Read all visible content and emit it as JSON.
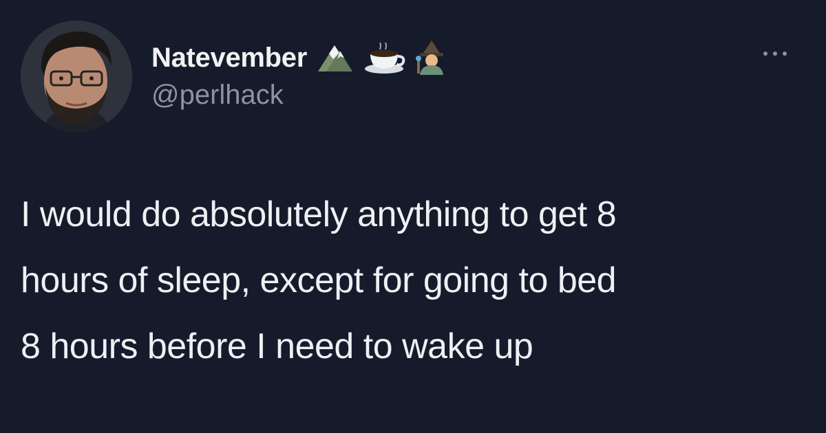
{
  "tweet": {
    "display_name": "Natevember",
    "handle": "@perlhack",
    "name_emojis": [
      "mountain-icon",
      "coffee-icon",
      "mage-icon"
    ],
    "more_icon": "ellipsis-icon",
    "text_lines": [
      "I would do absolutely anything to get 8",
      "hours of sleep, except for going to bed",
      "8 hours before I need to wake up"
    ]
  },
  "colors": {
    "background": "#161b2b",
    "text_primary": "#eef0f3",
    "text_secondary": "#8b93a3"
  }
}
